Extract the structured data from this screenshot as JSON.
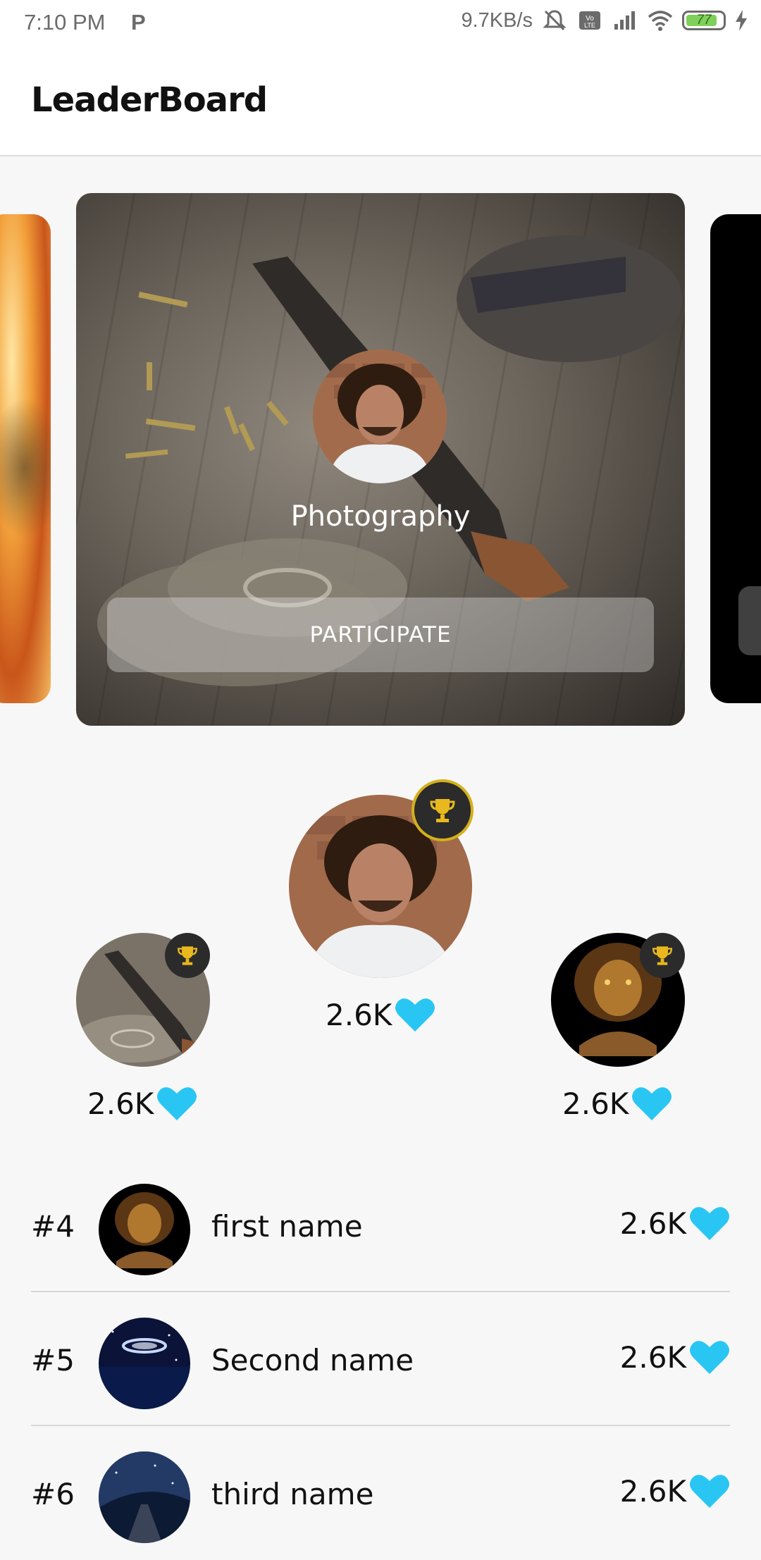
{
  "status_bar": {
    "time": "7:10 PM",
    "p_icon": "P",
    "net_speed": "9.7KB/s",
    "battery_level": "77",
    "icons": [
      "mute-icon",
      "volte-icon",
      "signal-icon",
      "wifi-icon",
      "battery-icon",
      "charging-icon"
    ]
  },
  "app_bar": {
    "title": "LeaderBoard"
  },
  "carousel": {
    "active_card": {
      "title": "Photography",
      "button_label": "PARTICIPATE"
    }
  },
  "podium": {
    "first": {
      "score": "2.6K",
      "icon": "trophy-icon"
    },
    "second": {
      "score": "2.6K",
      "icon": "trophy-icon"
    },
    "third": {
      "score": "2.6K",
      "icon": "trophy-icon"
    }
  },
  "leaderboard": [
    {
      "rank": "#4",
      "name": "first name",
      "score": "2.6K"
    },
    {
      "rank": "#5",
      "name": "Second name",
      "score": "2.6K"
    },
    {
      "rank": "#6",
      "name": "third name",
      "score": "2.6K"
    }
  ],
  "colors": {
    "heart": "#29c6f3",
    "trophy": "#e8b81e",
    "badge_ring": "#d4b01c",
    "appbar_bg": "#ffffff",
    "page_bg": "#f7f7f7"
  }
}
